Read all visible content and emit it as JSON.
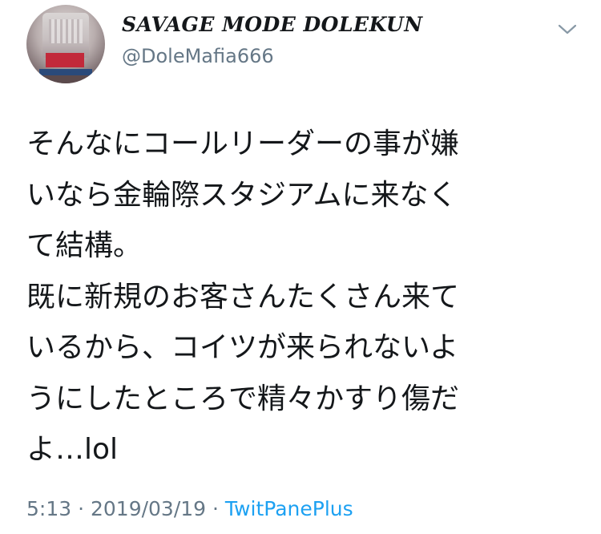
{
  "user": {
    "display_name": "SAVAGE MODE DOLEKUN",
    "handle": "@DoleMafia666",
    "avatar_icon": "profile-avatar-image"
  },
  "menu": {
    "icon": "chevron-down-icon"
  },
  "tweet": {
    "lines": [
      "そんなにコールリーダーの事が嫌",
      "いなら金輪際スタジアムに来なく",
      "て結構。",
      "既に新規のお客さんたくさん来て",
      "いるから、コイツが来られないよ",
      "うにしたところで精々かすり傷だ",
      "よ…lol"
    ]
  },
  "meta": {
    "time": "5:13",
    "separator": " · ",
    "date": "2019/03/19",
    "source": "TwitPanePlus"
  },
  "colors": {
    "text": "#14171a",
    "secondary": "#657786",
    "link": "#1da1f2"
  }
}
